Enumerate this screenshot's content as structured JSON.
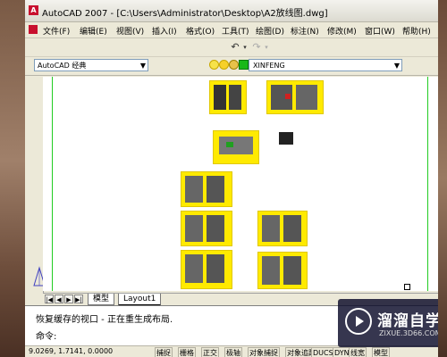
{
  "window": {
    "title": "AutoCAD 2007 - [C:\\Users\\Administrator\\Desktop\\A2放线图.dwg]"
  },
  "menu": [
    "文件(F)",
    "编辑(E)",
    "视图(V)",
    "插入(I)",
    "格式(O)",
    "工具(T)",
    "绘图(D)",
    "标注(N)",
    "修改(M)",
    "窗口(W)",
    "帮助(H)"
  ],
  "workspace": {
    "value": "AutoCAD 经典"
  },
  "layer": {
    "value": "XINFENG"
  },
  "tabs": {
    "model": "模型",
    "layout": "Layout1"
  },
  "command": {
    "line1": "恢复缓存的视口 - 正在重生成布局.",
    "prompt": "命令:"
  },
  "status": {
    "coords": "9.0269,  1.7141,  0.0000",
    "buttons": [
      "捕捉",
      "栅格",
      "正交",
      "极轴",
      "对象捕捉",
      "对象追踪",
      "DUCS",
      "DYN",
      "线宽",
      "模型"
    ]
  },
  "watermark": {
    "cn": "溜溜自学",
    "en": "ZIXUE.3D66.COM"
  },
  "colors": {
    "sheet": "#ffea00",
    "guide": "#22cc22",
    "brand": "#c8102e"
  }
}
